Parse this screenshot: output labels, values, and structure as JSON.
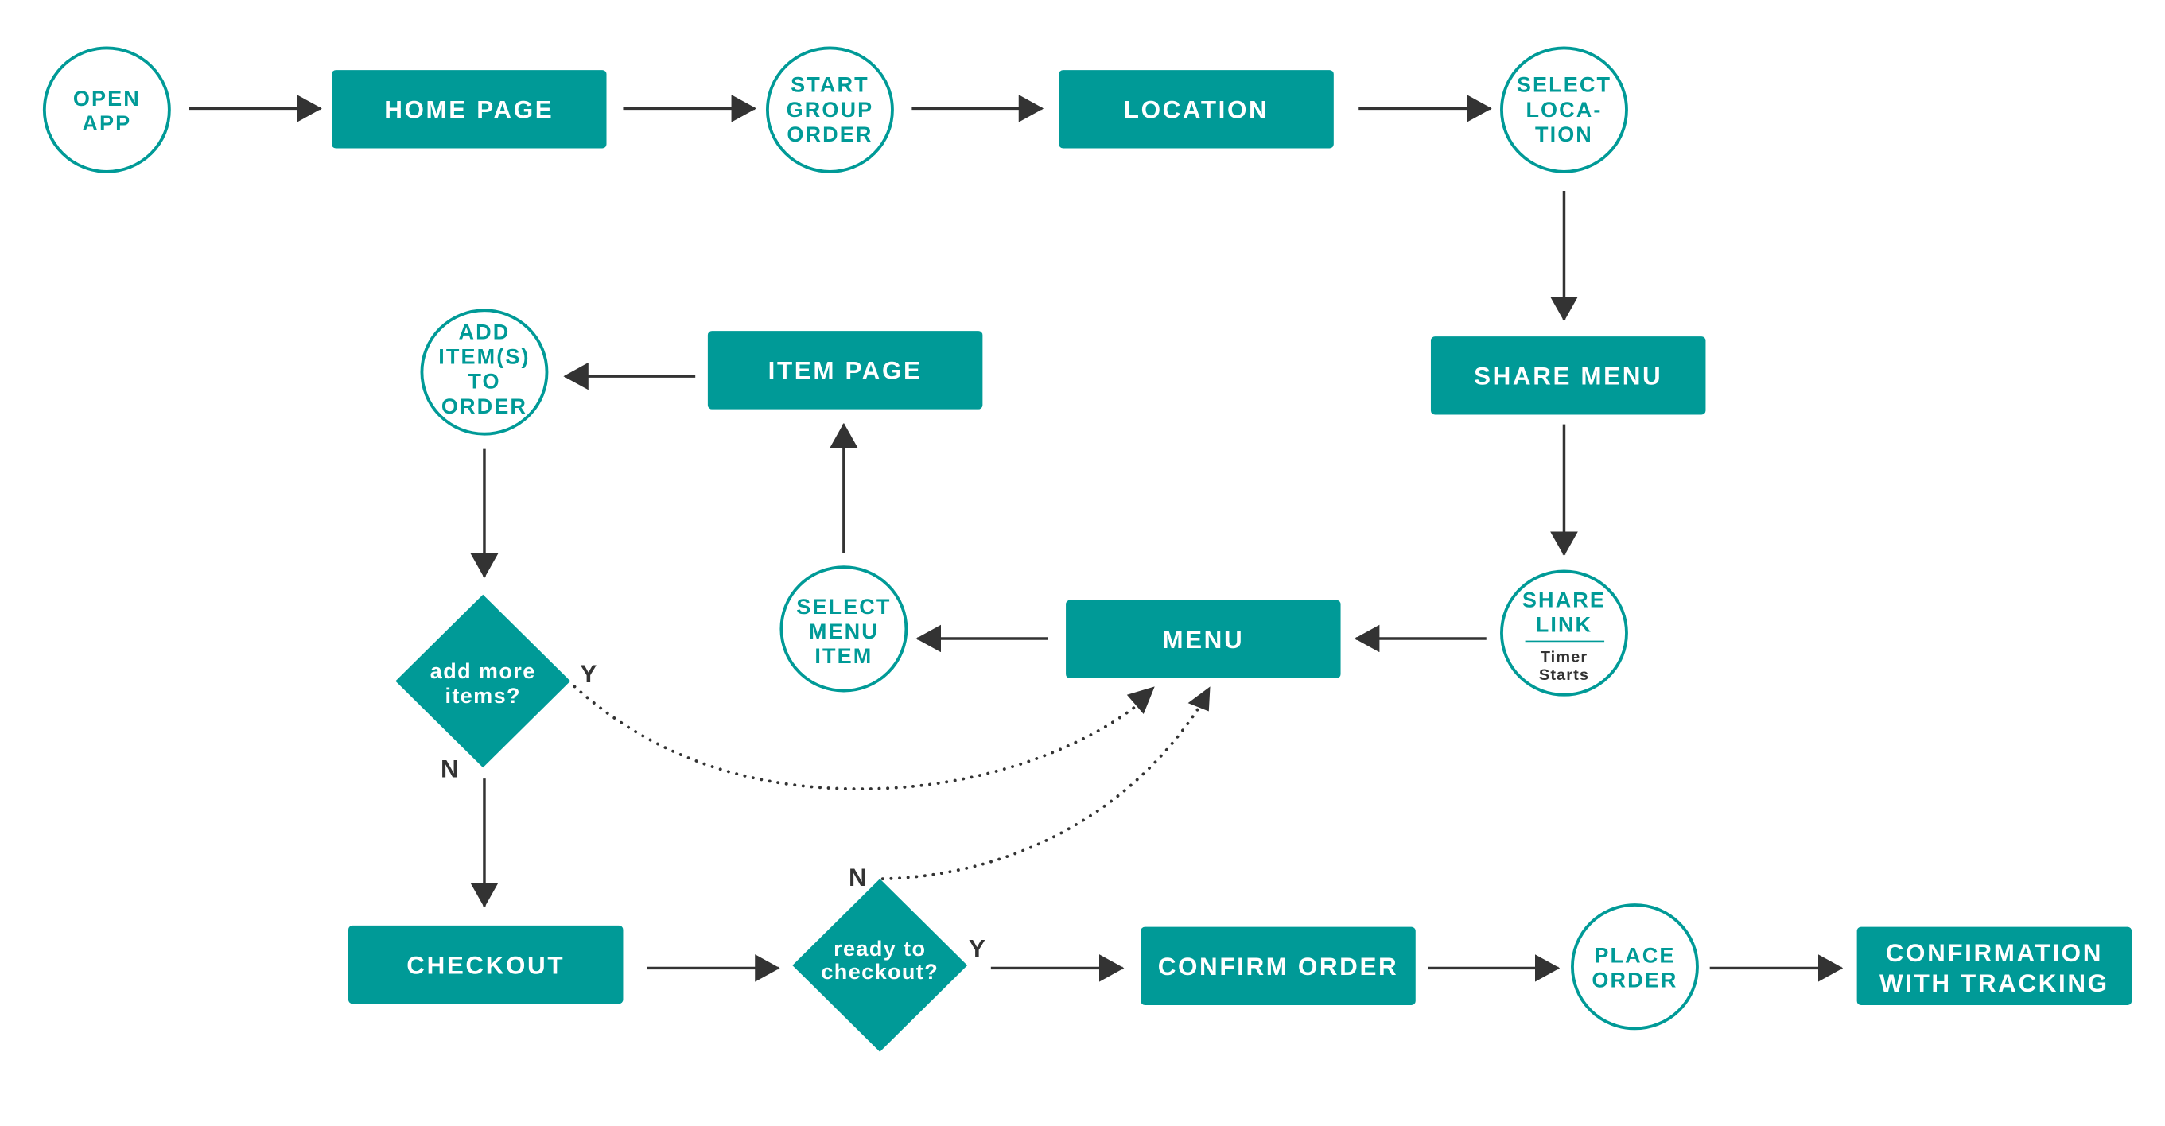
{
  "colors": {
    "primary": "#009a97",
    "arrow": "#333333",
    "background": "#ffffff"
  },
  "nodes": {
    "open_app": [
      "OPEN",
      "APP"
    ],
    "home_page": "HOME PAGE",
    "start_group_order": [
      "START",
      "GROUP",
      "ORDER"
    ],
    "location": "LOCATION",
    "select_location": [
      "SELECT",
      "LOCA-",
      "TION"
    ],
    "share_menu": "SHARE MENU",
    "share_link": [
      "SHARE",
      "LINK"
    ],
    "share_link_note": [
      "Timer",
      "Starts"
    ],
    "menu": "MENU",
    "select_menu_item": [
      "SELECT",
      "MENU",
      "ITEM"
    ],
    "item_page": "ITEM PAGE",
    "add_items": [
      "ADD",
      "ITEM(S)",
      "TO",
      "ORDER"
    ],
    "add_more_items": [
      "add more",
      "items?"
    ],
    "checkout": "CHECKOUT",
    "ready_to_checkout": [
      "ready to",
      "checkout?"
    ],
    "confirm_order": "CONFIRM ORDER",
    "place_order": [
      "PLACE",
      "ORDER"
    ],
    "confirmation": [
      "CONFIRMATION",
      "WITH TRACKING"
    ]
  },
  "labels": {
    "add_more_yes": "Y",
    "add_more_no": "N",
    "ready_yes": "Y",
    "ready_no": "N"
  }
}
